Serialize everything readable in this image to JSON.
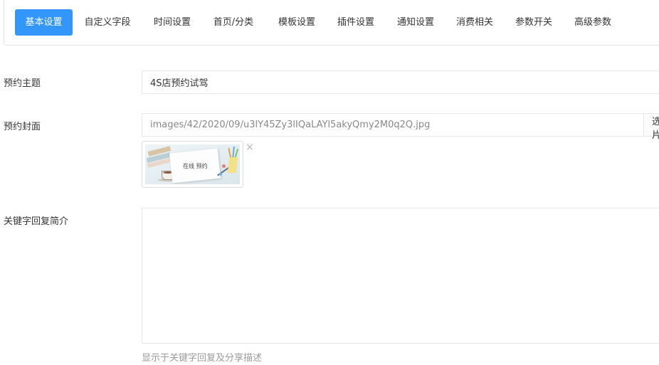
{
  "tabs": [
    {
      "label": "基本设置",
      "active": true
    },
    {
      "label": "自定义字段",
      "active": false
    },
    {
      "label": "时间设置",
      "active": false
    },
    {
      "label": "首页/分类",
      "active": false
    },
    {
      "label": "模板设置",
      "active": false
    },
    {
      "label": "插件设置",
      "active": false
    },
    {
      "label": "通知设置",
      "active": false
    },
    {
      "label": "消费相关",
      "active": false
    },
    {
      "label": "参数开关",
      "active": false
    },
    {
      "label": "高级参数",
      "active": false
    }
  ],
  "form": {
    "subject": {
      "label": "预约主题",
      "value": "4S店预约试驾"
    },
    "cover": {
      "label": "预约封面",
      "value": "images/42/2020/09/u3lY45Zy3lIQaLAYl5akyQmy2M0q2Q.jpg",
      "select_label": "选择图片",
      "thumbnail_text": "在线 预约",
      "remove_glyph": "×"
    },
    "keyword_intro": {
      "label": "关键字回复简介",
      "value": "",
      "help": "显示于关键字回复及分享描述"
    }
  },
  "colors": {
    "accent": "#3296fa",
    "border": "#e6e6e6",
    "help_text": "#9a9a9a"
  }
}
